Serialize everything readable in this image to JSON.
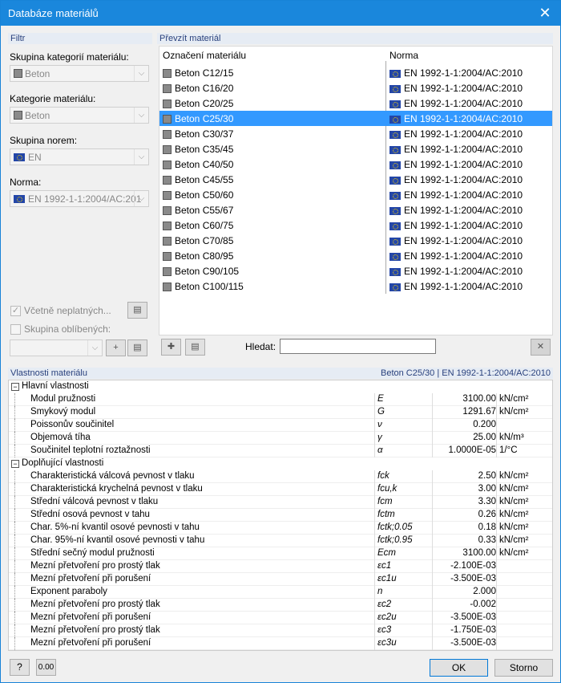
{
  "window": {
    "title": "Databáze materiálů",
    "close": "✕"
  },
  "filter": {
    "header": "Filtr",
    "group_label": "Skupina kategorií materiálu:",
    "group_value": "Beton",
    "category_label": "Kategorie materiálu:",
    "category_value": "Beton",
    "norm_group_label": "Skupina norem:",
    "norm_group_value": "EN",
    "norm_label": "Norma:",
    "norm_value": "EN 1992-1-1:2004/AC:201",
    "include_invalid": "Včetně neplatných...",
    "favorites": "Skupina oblíbených:"
  },
  "material_list": {
    "header": "Převzít materiál",
    "col_name": "Označení materiálu",
    "col_norm": "Norma",
    "rows": [
      {
        "name": "Beton C12/15",
        "norm": "EN 1992-1-1:2004/AC:2010"
      },
      {
        "name": "Beton C16/20",
        "norm": "EN 1992-1-1:2004/AC:2010"
      },
      {
        "name": "Beton C20/25",
        "norm": "EN 1992-1-1:2004/AC:2010"
      },
      {
        "name": "Beton C25/30",
        "norm": "EN 1992-1-1:2004/AC:2010"
      },
      {
        "name": "Beton C30/37",
        "norm": "EN 1992-1-1:2004/AC:2010"
      },
      {
        "name": "Beton C35/45",
        "norm": "EN 1992-1-1:2004/AC:2010"
      },
      {
        "name": "Beton C40/50",
        "norm": "EN 1992-1-1:2004/AC:2010"
      },
      {
        "name": "Beton C45/55",
        "norm": "EN 1992-1-1:2004/AC:2010"
      },
      {
        "name": "Beton C50/60",
        "norm": "EN 1992-1-1:2004/AC:2010"
      },
      {
        "name": "Beton C55/67",
        "norm": "EN 1992-1-1:2004/AC:2010"
      },
      {
        "name": "Beton C60/75",
        "norm": "EN 1992-1-1:2004/AC:2010"
      },
      {
        "name": "Beton C70/85",
        "norm": "EN 1992-1-1:2004/AC:2010"
      },
      {
        "name": "Beton C80/95",
        "norm": "EN 1992-1-1:2004/AC:2010"
      },
      {
        "name": "Beton C90/105",
        "norm": "EN 1992-1-1:2004/AC:2010"
      },
      {
        "name": "Beton C100/115",
        "norm": "EN 1992-1-1:2004/AC:2010"
      }
    ],
    "selected_index": 3,
    "search_label": "Hledat:",
    "search_value": ""
  },
  "properties": {
    "header": "Vlastnosti materiálu",
    "header_right": "Beton C25/30  |  EN 1992-1-1:2004/AC:2010",
    "sections": [
      {
        "title": "Hlavní vlastnosti",
        "rows": [
          {
            "name": "Modul pružnosti",
            "symbol": "E",
            "value": "3100.00",
            "unit": "kN/cm²"
          },
          {
            "name": "Smykový modul",
            "symbol": "G",
            "value": "1291.67",
            "unit": "kN/cm²"
          },
          {
            "name": "Poissonův součinitel",
            "symbol": "ν",
            "value": "0.200",
            "unit": ""
          },
          {
            "name": "Objemová tíha",
            "symbol": "γ",
            "value": "25.00",
            "unit": "kN/m³"
          },
          {
            "name": "Součinitel teplotní roztažnosti",
            "symbol": "α",
            "value": "1.0000E-05",
            "unit": "1/°C"
          }
        ]
      },
      {
        "title": "Doplňující vlastnosti",
        "rows": [
          {
            "name": "Charakteristická válcová pevnost v tlaku",
            "symbol": "fck",
            "value": "2.50",
            "unit": "kN/cm²"
          },
          {
            "name": "Charakteristická krychelná pevnost v tlaku",
            "symbol": "fcu,k",
            "value": "3.00",
            "unit": "kN/cm²"
          },
          {
            "name": "Střední válcová pevnost v tlaku",
            "symbol": "fcm",
            "value": "3.30",
            "unit": "kN/cm²"
          },
          {
            "name": "Střední osová pevnost v tahu",
            "symbol": "fctm",
            "value": "0.26",
            "unit": "kN/cm²"
          },
          {
            "name": "Char. 5%-ní kvantil osové pevnosti v tahu",
            "symbol": "fctk;0.05",
            "value": "0.18",
            "unit": "kN/cm²"
          },
          {
            "name": "Char. 95%-ní kvantil osové pevnosti v tahu",
            "symbol": "fctk;0.95",
            "value": "0.33",
            "unit": "kN/cm²"
          },
          {
            "name": "Střední sečný modul pružnosti",
            "symbol": "Ecm",
            "value": "3100.00",
            "unit": "kN/cm²"
          },
          {
            "name": "Mezní přetvoření pro prostý tlak",
            "symbol": "εc1",
            "value": "-2.100E-03",
            "unit": ""
          },
          {
            "name": "Mezní přetvoření při porušení",
            "symbol": "εc1u",
            "value": "-3.500E-03",
            "unit": ""
          },
          {
            "name": "Exponent paraboly",
            "symbol": "n",
            "value": "2.000",
            "unit": ""
          },
          {
            "name": "Mezní přetvoření pro prostý tlak",
            "symbol": "εc2",
            "value": "-0.002",
            "unit": ""
          },
          {
            "name": "Mezní přetvoření při porušení",
            "symbol": "εc2u",
            "value": "-3.500E-03",
            "unit": ""
          },
          {
            "name": "Mezní přetvoření pro prostý tlak",
            "symbol": "εc3",
            "value": "-1.750E-03",
            "unit": ""
          },
          {
            "name": "Mezní přetvoření při porušení",
            "symbol": "εc3u",
            "value": "-3.500E-03",
            "unit": ""
          }
        ]
      }
    ]
  },
  "footer": {
    "ok": "OK",
    "cancel": "Storno",
    "units_label": "0.00"
  }
}
